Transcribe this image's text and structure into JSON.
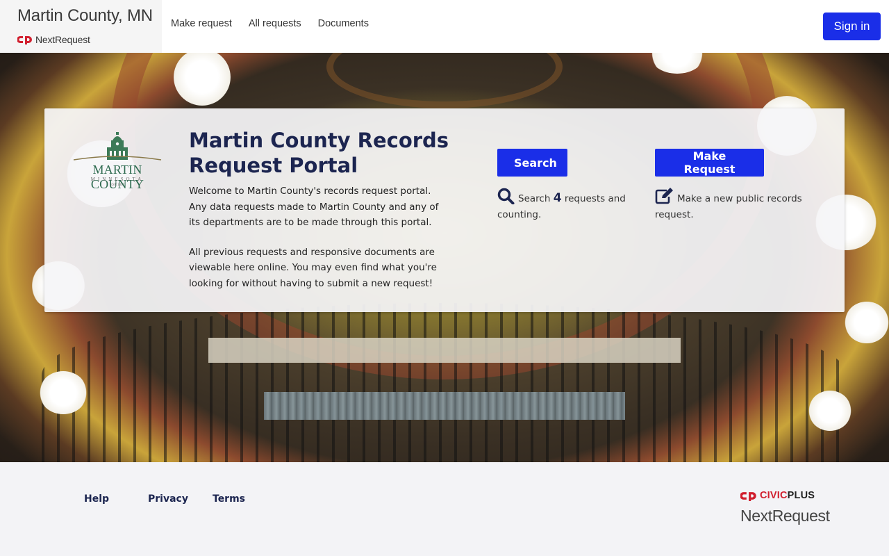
{
  "header": {
    "brand_name": "Martin County, MN",
    "brand_logo_text": "NextRequest",
    "nav": [
      {
        "label": "Make request"
      },
      {
        "label": "All requests"
      },
      {
        "label": "Documents"
      }
    ],
    "signin_label": "Sign in"
  },
  "card": {
    "seal": {
      "name": "MARTIN COUNTY",
      "sub": "MINNESOTA",
      "est": "EST 1857"
    },
    "title": "Martin County Records Request Portal",
    "intro_p1": "Welcome to Martin County's records request portal. Any data requests made to Martin County and any of its departments are to be made through this portal.",
    "intro_p2": "All previous requests and responsive documents are viewable here online. You may even find what you're looking for without having to submit a new request!",
    "search": {
      "button_label": "Search",
      "text_before": "Search",
      "count": "4",
      "text_after": "requests and counting.",
      "icon": "search-icon"
    },
    "make": {
      "button_label": "Make Request",
      "text": "Make a new public records request.",
      "icon": "edit-icon"
    }
  },
  "footer": {
    "links": [
      {
        "label": "Help"
      },
      {
        "label": "Privacy"
      },
      {
        "label": "Terms"
      }
    ],
    "civic_brand": "CIVIC",
    "civic_brand_plus": "PLUS",
    "product": "NextRequest"
  },
  "colors": {
    "primary": "#1a2ee8",
    "heading": "#1c2550",
    "brand_red": "#d11f2e"
  }
}
